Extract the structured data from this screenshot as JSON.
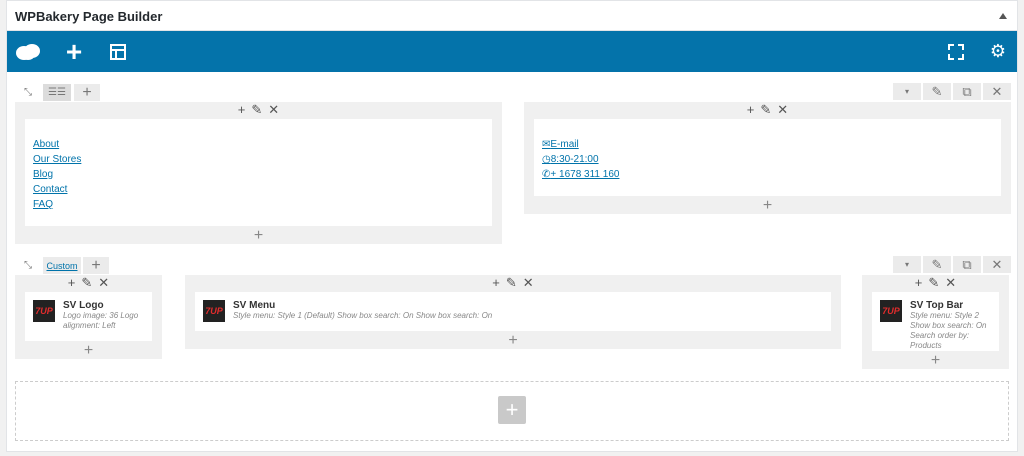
{
  "panel": {
    "title": "WPBakery Page Builder"
  },
  "navbar": {
    "logo": "cloud-logo-icon",
    "add": "+",
    "layout": "layout-icon",
    "fullscreen": "fullscreen-icon",
    "settings": "gear-icon"
  },
  "row1": {
    "col1": {
      "links": [
        "About",
        "Our Stores",
        "Blog",
        "Contact",
        "FAQ"
      ]
    },
    "col2": {
      "email": "E-mail",
      "hours": "8:30-21:00",
      "phone": "+ 1678 311 160"
    }
  },
  "row2": {
    "layout_label": "Custom",
    "col1": {
      "title": "SV Logo",
      "desc": "Logo image: 36  Logo alignment: Left"
    },
    "col2": {
      "title": "SV Menu",
      "desc": "Style menu: Style 1 (Default)  Show box search: On  Show box search: On"
    },
    "col3": {
      "title": "SV Top Bar",
      "desc": "Style menu: Style 2  Show box search: On  Search order by: Products"
    }
  },
  "logo_badge": "7UP",
  "colors": {
    "navbar": "#0473aa",
    "link": "#0073aa"
  }
}
